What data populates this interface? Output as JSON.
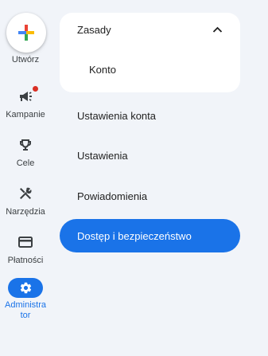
{
  "rail": {
    "create_label": "Utwórz",
    "items": [
      {
        "label": "Kampanie",
        "icon": "campaign-icon"
      },
      {
        "label": "Cele",
        "icon": "trophy-icon"
      },
      {
        "label": "Narzędzia",
        "icon": "tools-icon"
      },
      {
        "label": "Płatności",
        "icon": "credit-card-icon"
      },
      {
        "label_line1": "Administra",
        "label_line2": "tor",
        "icon": "gear-icon",
        "active": true
      }
    ]
  },
  "menu": {
    "section": {
      "label": "Zasady",
      "expanded": true,
      "children": [
        {
          "label": "Konto"
        }
      ]
    },
    "items": [
      {
        "label": "Ustawienia konta"
      },
      {
        "label": "Ustawienia"
      },
      {
        "label": "Powiadomienia"
      },
      {
        "label": "Dostęp i bezpieczeństwo",
        "active": true
      }
    ]
  },
  "colors": {
    "accent": "#1a73e8",
    "background": "#f1f4f9",
    "badge": "#d93025"
  }
}
